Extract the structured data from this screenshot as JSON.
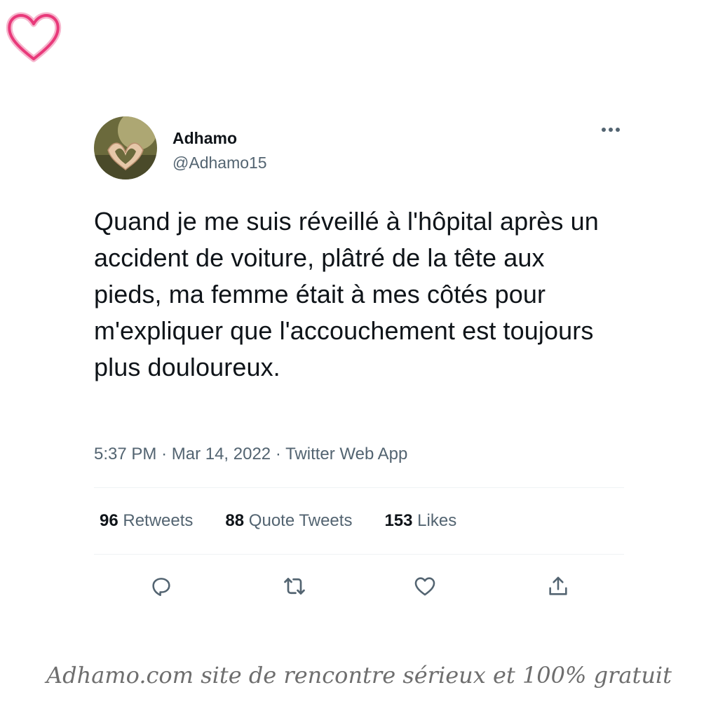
{
  "brand": {
    "logo_icon": "heart-outline-icon",
    "logo_color": "#e8397a"
  },
  "tweet": {
    "author_name": "Adhamo",
    "author_handle": "@Adhamo15",
    "more_icon": "more-horizontal-icon",
    "text": "Quand je me suis réveillé à l'hôpital après un accident de voiture, plâtré de la tête aux pieds, ma femme était à mes côtés pour m'expliquer que l'accouchement est toujours plus douloureux.",
    "time": "5:37 PM",
    "separator": "·",
    "date": "Mar 14, 2022",
    "source": "Twitter Web App",
    "stats": {
      "retweets_count": "96",
      "retweets_label": "Retweets",
      "quotes_count": "88",
      "quotes_label": "Quote Tweets",
      "likes_count": "153",
      "likes_label": "Likes"
    },
    "actions": [
      "reply-icon",
      "retweet-icon",
      "like-icon",
      "share-icon"
    ]
  },
  "caption": "Adhamo.com site de rencontre sérieux et 100% gratuit",
  "colors": {
    "text_primary": "#0f1419",
    "text_secondary": "#536471",
    "divider": "#eff3f4"
  }
}
